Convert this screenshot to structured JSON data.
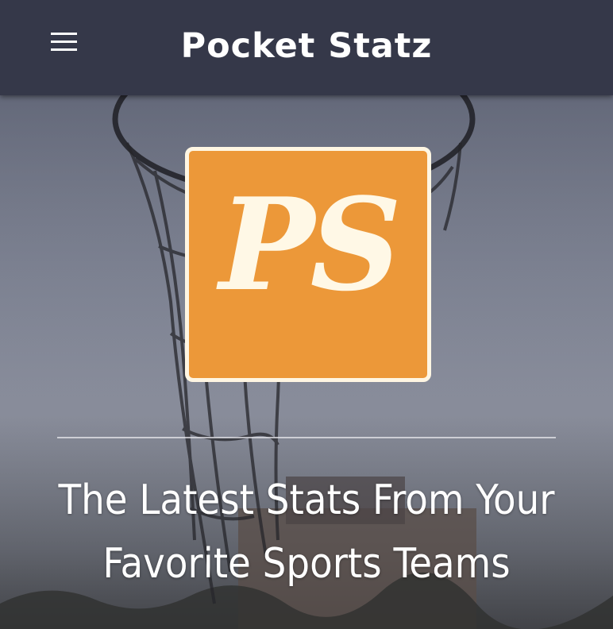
{
  "header": {
    "menu_icon": "hamburger-menu-icon",
    "title": "Pocket Statz"
  },
  "hero": {
    "logo": {
      "text": "PS",
      "background_color": "#ec9839",
      "text_color": "#fff8e6"
    },
    "tagline": "The Latest Stats From Your Favorite Sports Teams"
  },
  "colors": {
    "app_bar": "#353849",
    "accent": "#ec9839"
  }
}
